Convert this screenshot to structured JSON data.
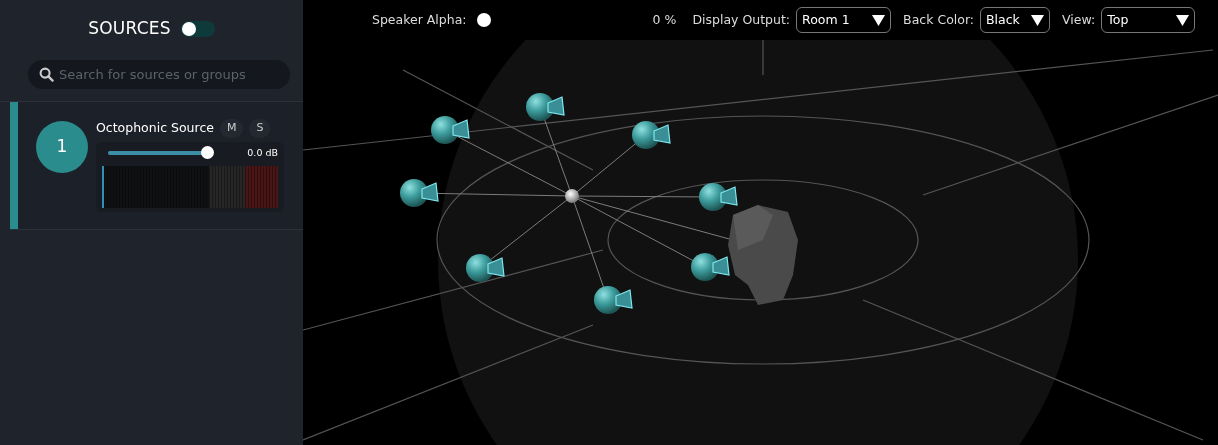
{
  "sidebar": {
    "title": "SOURCES",
    "toggle": {
      "on": false
    },
    "search": {
      "placeholder": "Search for sources or groups"
    },
    "sources": [
      {
        "number": "1",
        "name": "Octophonic Source",
        "selected": true,
        "mute_label": "M",
        "solo_label": "S",
        "muted": false,
        "soloed": false,
        "gain": {
          "level": 0.95,
          "reading": "0.0 dB"
        },
        "meter": {
          "level": 0.01
        }
      }
    ]
  },
  "toolbar": {
    "speaker_alpha": {
      "label": "Speaker Alpha:",
      "level": 0,
      "reading": "0 %"
    },
    "selects": [
      {
        "label": "Display Output:",
        "value": "Room 1"
      },
      {
        "label": "Back Color:",
        "value": "Black"
      },
      {
        "label": "View:",
        "value": "Top"
      }
    ]
  }
}
